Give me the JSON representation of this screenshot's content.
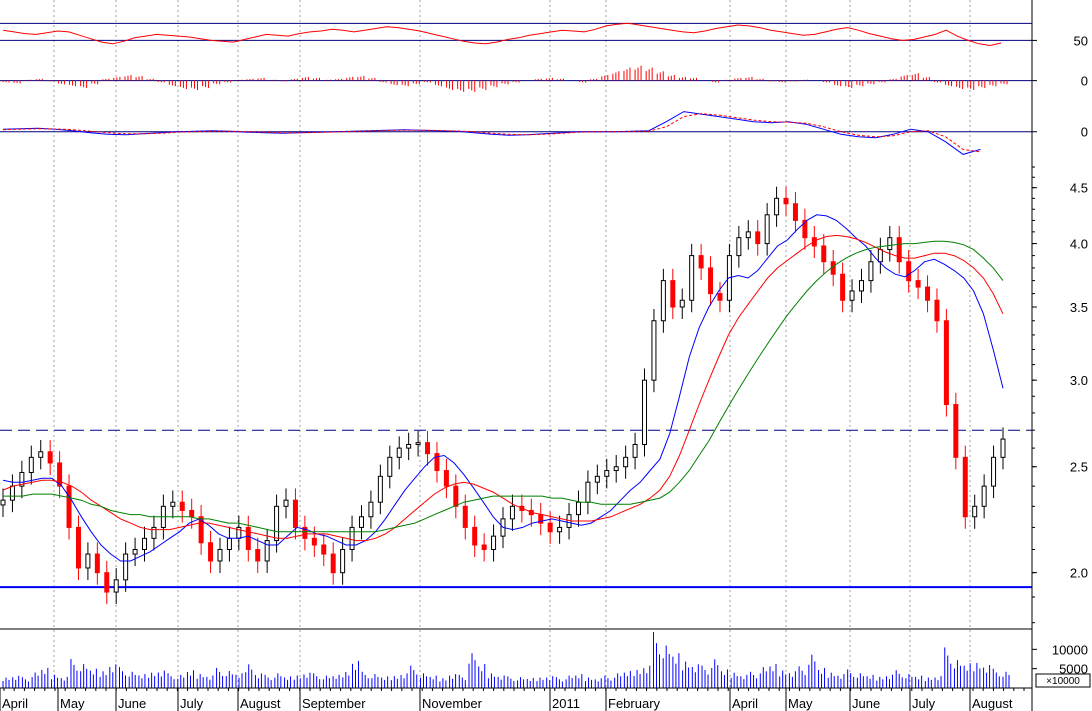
{
  "colors": {
    "up": "#000000",
    "down": "#ff0000",
    "ma_short": "#0000ff",
    "ma_mid": "#ff0000",
    "ma_long": "#008000",
    "rsi": "#ff0000",
    "histogram": "#ff0000",
    "macd": "#0000ff",
    "signal": "#ff0000",
    "reference_line": "#000080",
    "support_line": "#0000ff",
    "volume": "#0000ff",
    "grid": "#a0a0a0"
  },
  "chart_data": [
    {
      "type": "line",
      "panel": "rsi",
      "y_ticks": [
        50
      ],
      "reference_levels": [
        70,
        50
      ],
      "x_step_days": 4,
      "values": [
        62,
        60,
        58,
        57,
        59,
        61,
        60,
        56,
        52,
        48,
        46,
        49,
        53,
        55,
        57,
        56,
        55,
        54,
        52,
        50,
        49,
        48,
        51,
        54,
        57,
        56,
        55,
        58,
        60,
        61,
        63,
        62,
        60,
        62,
        64,
        66,
        65,
        63,
        61,
        58,
        55,
        52,
        49,
        47,
        46,
        48,
        51,
        53,
        56,
        58,
        60,
        62,
        61,
        60,
        63,
        67,
        69,
        70,
        68,
        66,
        64,
        62,
        60,
        59,
        61,
        64,
        66,
        68,
        67,
        65,
        62,
        60,
        58,
        56,
        57,
        60,
        63,
        65,
        62,
        58,
        55,
        52,
        50,
        51,
        54,
        57,
        62,
        55,
        50,
        46,
        44,
        47
      ]
    },
    {
      "type": "bar",
      "panel": "macd-histogram",
      "y_ticks": [
        0
      ],
      "x_step_days": 4,
      "values": [
        -0.01,
        -0.015,
        0.005,
        0.01,
        -0.005,
        -0.02,
        -0.03,
        -0.04,
        -0.02,
        0.01,
        0.02,
        0.03,
        0.025,
        0.01,
        -0.01,
        -0.03,
        -0.045,
        -0.05,
        -0.04,
        -0.02,
        -0.01,
        0.005,
        0.01,
        0.015,
        0.005,
        -0.005,
        0.01,
        0.02,
        0.015,
        0.005,
        0.01,
        0.02,
        0.025,
        0.015,
        -0.01,
        -0.025,
        -0.03,
        -0.02,
        -0.01,
        -0.03,
        -0.05,
        -0.06,
        -0.06,
        -0.05,
        -0.035,
        -0.02,
        -0.01,
        0.0,
        0.01,
        0.015,
        0.01,
        0.0,
        -0.01,
        0.01,
        0.03,
        0.05,
        0.07,
        0.08,
        0.07,
        0.05,
        0.03,
        0.02,
        0.015,
        0.0,
        -0.01,
        0.005,
        0.015,
        0.02,
        0.01,
        -0.005,
        -0.01,
        -0.005,
        0.005,
        0.0,
        -0.01,
        -0.03,
        -0.04,
        -0.03,
        -0.02,
        -0.01,
        0.01,
        0.03,
        0.04,
        0.02,
        -0.01,
        -0.03,
        -0.045,
        -0.05,
        -0.04,
        -0.03,
        -0.02
      ]
    },
    {
      "type": "line",
      "panel": "macd",
      "y_ticks": [
        0
      ],
      "reference_levels": [
        0
      ],
      "x_step_days": 4,
      "series": [
        {
          "values": [
            0.05,
            0.06,
            0.07,
            0.05,
            0.02,
            -0.02,
            -0.05,
            -0.06,
            -0.04,
            -0.02,
            0.0,
            0.01,
            0.02,
            0.01,
            -0.01,
            -0.02,
            -0.03,
            -0.02,
            -0.01,
            0.0,
            0.01,
            0.02,
            0.03,
            0.04,
            0.03,
            0.02,
            0.01,
            -0.02,
            -0.05,
            -0.07,
            -0.06,
            -0.04,
            -0.02,
            0.0,
            0.0,
            0.0,
            0.01,
            0.02,
            0.2,
            0.4,
            0.35,
            0.3,
            0.25,
            0.2,
            0.18,
            0.2,
            0.15,
            0.05,
            -0.05,
            -0.1,
            -0.12,
            -0.05,
            0.05,
            0.0,
            -0.2,
            -0.45,
            -0.35
          ]
        },
        {
          "values": [
            0.04,
            0.05,
            0.06,
            0.055,
            0.04,
            0.01,
            -0.02,
            -0.04,
            -0.04,
            -0.03,
            -0.01,
            0.0,
            0.01,
            0.01,
            0.0,
            -0.01,
            -0.02,
            -0.02,
            -0.015,
            -0.005,
            0.005,
            0.015,
            0.025,
            0.03,
            0.03,
            0.025,
            0.015,
            0.0,
            -0.03,
            -0.05,
            -0.06,
            -0.05,
            -0.03,
            -0.01,
            0.0,
            0.0,
            0.005,
            0.01,
            0.1,
            0.3,
            0.36,
            0.33,
            0.28,
            0.23,
            0.2,
            0.19,
            0.17,
            0.1,
            0.0,
            -0.07,
            -0.1,
            -0.08,
            0.0,
            0.02,
            -0.1,
            -0.35,
            -0.4
          ]
        }
      ]
    },
    {
      "type": "candlestick",
      "panel": "price",
      "scale": "log",
      "y_ticks": [
        2.0,
        2.5,
        3.0,
        3.5,
        4.0,
        4.5
      ],
      "x_labels": [
        "April",
        "May",
        "June",
        "July",
        "August",
        "September",
        "November",
        "2011",
        "February",
        "April",
        "May",
        "June",
        "July",
        "August"
      ],
      "reference_levels": [
        2.7,
        1.94
      ],
      "x_step_days": 4,
      "close": [
        2.33,
        2.4,
        2.47,
        2.55,
        2.58,
        2.52,
        2.4,
        2.2,
        2.02,
        2.08,
        2.0,
        1.92,
        1.97,
        2.08,
        2.1,
        2.15,
        2.2,
        2.3,
        2.32,
        2.28,
        2.25,
        2.13,
        2.05,
        2.1,
        2.15,
        2.2,
        2.1,
        2.05,
        2.14,
        2.3,
        2.33,
        2.2,
        2.15,
        2.12,
        2.08,
        2.0,
        2.1,
        2.2,
        2.25,
        2.32,
        2.45,
        2.55,
        2.6,
        2.62,
        2.63,
        2.57,
        2.48,
        2.4,
        2.3,
        2.2,
        2.12,
        2.1,
        2.16,
        2.24,
        2.3,
        2.28,
        2.26,
        2.22,
        2.18,
        2.2,
        2.26,
        2.32,
        2.42,
        2.45,
        2.48,
        2.5,
        2.55,
        2.62,
        3.0,
        3.4,
        3.7,
        3.5,
        3.55,
        3.9,
        3.8,
        3.6,
        3.55,
        3.9,
        4.05,
        4.1,
        4.0,
        4.25,
        4.4,
        4.35,
        4.2,
        4.05,
        3.98,
        3.85,
        3.75,
        3.55,
        3.62,
        3.7,
        3.85,
        3.95,
        4.05,
        3.85,
        3.7,
        3.65,
        3.55,
        3.4,
        2.85,
        2.55,
        2.25,
        2.3,
        2.4,
        2.55,
        2.65
      ],
      "series": [
        {
          "name": "",
          "values": [
            2.43,
            2.42,
            2.42,
            2.43,
            2.44,
            2.44,
            2.4,
            2.33,
            2.25,
            2.18,
            2.12,
            2.08,
            2.05,
            2.05,
            2.07,
            2.09,
            2.12,
            2.15,
            2.18,
            2.22,
            2.24,
            2.21,
            2.17,
            2.15,
            2.15,
            2.16,
            2.14,
            2.12,
            2.12,
            2.16,
            2.2,
            2.19,
            2.17,
            2.16,
            2.14,
            2.12,
            2.12,
            2.14,
            2.18,
            2.24,
            2.31,
            2.38,
            2.44,
            2.5,
            2.55,
            2.56,
            2.52,
            2.46,
            2.39,
            2.32,
            2.25,
            2.2,
            2.19,
            2.2,
            2.22,
            2.23,
            2.24,
            2.23,
            2.22,
            2.21,
            2.22,
            2.25,
            2.28,
            2.33,
            2.38,
            2.42,
            2.48,
            2.54,
            2.68,
            2.9,
            3.15,
            3.35,
            3.5,
            3.62,
            3.72,
            3.74,
            3.72,
            3.78,
            3.88,
            3.98,
            4.03,
            4.12,
            4.2,
            4.25,
            4.24,
            4.2,
            4.13,
            4.05,
            3.98,
            3.88,
            3.8,
            3.75,
            3.73,
            3.78,
            3.85,
            3.87,
            3.83,
            3.78,
            3.72,
            3.62,
            3.45,
            3.2,
            2.95
          ]
        },
        {
          "name": "",
          "values": [
            2.38,
            2.4,
            2.41,
            2.42,
            2.43,
            2.43,
            2.42,
            2.4,
            2.37,
            2.33,
            2.3,
            2.27,
            2.24,
            2.22,
            2.2,
            2.19,
            2.19,
            2.19,
            2.2,
            2.21,
            2.22,
            2.22,
            2.21,
            2.2,
            2.19,
            2.18,
            2.17,
            2.16,
            2.15,
            2.15,
            2.16,
            2.17,
            2.17,
            2.17,
            2.16,
            2.15,
            2.14,
            2.14,
            2.15,
            2.17,
            2.2,
            2.24,
            2.28,
            2.32,
            2.36,
            2.39,
            2.41,
            2.42,
            2.41,
            2.39,
            2.37,
            2.34,
            2.31,
            2.29,
            2.27,
            2.26,
            2.25,
            2.24,
            2.23,
            2.23,
            2.23,
            2.24,
            2.25,
            2.27,
            2.29,
            2.31,
            2.34,
            2.38,
            2.45,
            2.56,
            2.7,
            2.85,
            3.0,
            3.15,
            3.3,
            3.42,
            3.52,
            3.62,
            3.72,
            3.8,
            3.86,
            3.92,
            3.98,
            4.03,
            4.06,
            4.07,
            4.06,
            4.04,
            4.01,
            3.97,
            3.93,
            3.9,
            3.88,
            3.88,
            3.9,
            3.92,
            3.92,
            3.9,
            3.86,
            3.8,
            3.72,
            3.6,
            3.45
          ]
        },
        {
          "name": "",
          "values": [
            2.35,
            2.35,
            2.35,
            2.36,
            2.36,
            2.36,
            2.35,
            2.34,
            2.33,
            2.31,
            2.3,
            2.28,
            2.27,
            2.26,
            2.26,
            2.25,
            2.25,
            2.25,
            2.25,
            2.25,
            2.24,
            2.24,
            2.23,
            2.22,
            2.22,
            2.21,
            2.2,
            2.19,
            2.18,
            2.18,
            2.18,
            2.18,
            2.18,
            2.18,
            2.18,
            2.18,
            2.18,
            2.18,
            2.18,
            2.19,
            2.2,
            2.21,
            2.22,
            2.24,
            2.26,
            2.28,
            2.3,
            2.32,
            2.33,
            2.34,
            2.35,
            2.35,
            2.35,
            2.35,
            2.35,
            2.35,
            2.34,
            2.34,
            2.33,
            2.32,
            2.32,
            2.31,
            2.31,
            2.31,
            2.31,
            2.32,
            2.33,
            2.34,
            2.37,
            2.42,
            2.48,
            2.56,
            2.64,
            2.74,
            2.84,
            2.94,
            3.04,
            3.14,
            3.24,
            3.34,
            3.44,
            3.53,
            3.62,
            3.7,
            3.77,
            3.83,
            3.88,
            3.92,
            3.95,
            3.97,
            3.98,
            3.99,
            4.0,
            4.0,
            4.01,
            4.02,
            4.02,
            4.01,
            3.99,
            3.95,
            3.88,
            3.8,
            3.7
          ]
        }
      ]
    },
    {
      "type": "bar",
      "panel": "volume",
      "y_ticks": [
        10000,
        5000
      ],
      "units": "×10000",
      "x_step_days": 4,
      "values": [
        3000,
        3500,
        2800,
        4000,
        5200,
        3800,
        3200,
        7500,
        6200,
        5000,
        4800,
        6800,
        5400,
        4200,
        3600,
        4400,
        5000,
        3800,
        3400,
        4600,
        4000,
        3600,
        5200,
        4400,
        3800,
        6800,
        4200,
        3400,
        3800,
        3000,
        3600,
        4400,
        3800,
        3200,
        3400,
        4600,
        7800,
        4200,
        3600,
        3000,
        3400,
        4200,
        5800,
        3800,
        3200,
        2800,
        4000,
        3400,
        9000,
        6200,
        4200,
        3600,
        3000,
        2800,
        2600,
        3000,
        3400,
        2800,
        3200,
        3600,
        3000,
        2800,
        3200,
        3800,
        4400,
        5200,
        6400,
        14500,
        11000,
        9000,
        7600,
        6800,
        5800,
        7400,
        4800,
        4400,
        3800,
        4200,
        5400,
        6200,
        5000,
        4800,
        5600,
        8600,
        5200,
        4400,
        4000,
        4800,
        3800,
        3400,
        3200,
        3800,
        4600,
        3600,
        3200,
        3000,
        3400,
        10500,
        7200,
        6400,
        7200,
        6600,
        5000,
        4200
      ]
    }
  ]
}
